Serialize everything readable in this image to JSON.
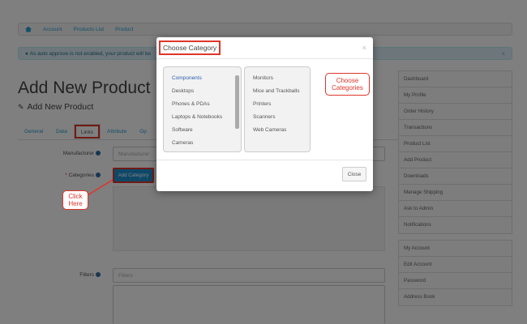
{
  "breadcrumb": {
    "items": [
      "Account",
      "Products List",
      "Product"
    ]
  },
  "alert": {
    "text": "As auto approve is not enabled, your product will be",
    "close": "×"
  },
  "page": {
    "title": "Add New Product",
    "subtitle": "Add New Product"
  },
  "tabs": [
    "General",
    "Data",
    "Links",
    "Attribute",
    "Op"
  ],
  "form": {
    "manufacturer_label": "Manufacturer",
    "manufacturer_placeholder": "Manufacturer",
    "categories_label": "Categories",
    "add_category_label": "Add Category",
    "filters_label": "Filters",
    "filters_placeholder": "Filters"
  },
  "callouts": {
    "click_here": "Click Here",
    "choose_categories": "Choose Categories"
  },
  "sidebar": {
    "group1": [
      "Dashboard",
      "My Profile",
      "Order History",
      "Transactions",
      "Product List",
      "Add Product",
      "Downloads",
      "Manage Shipping",
      "Ask to Admin",
      "Notifications"
    ],
    "group2": [
      "My Account",
      "Edit Account",
      "Password",
      "Address Book"
    ]
  },
  "modal": {
    "title": "Choose Category",
    "close_x": "×",
    "left_list": [
      "Components",
      "Desktops",
      "Phones & PDAs",
      "Laptops & Notebooks",
      "Software",
      "Cameras"
    ],
    "right_list": [
      "Monitors",
      "Mice and Trackballs",
      "Printers",
      "Scanners",
      "Web Cameras"
    ],
    "close_button": "Close"
  }
}
